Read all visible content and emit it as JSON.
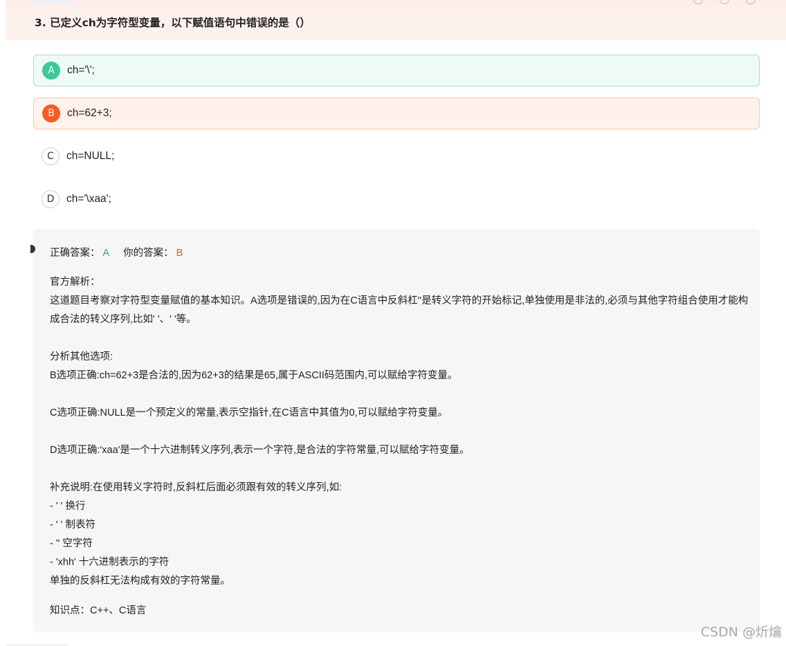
{
  "question": {
    "title": "3. 已定义ch为字符型变量，以下赋值语句中错误的是（）"
  },
  "options": [
    {
      "letter": "A",
      "text": "ch='\\';",
      "state": "correct"
    },
    {
      "letter": "B",
      "text": "ch=62+3;",
      "state": "wrong"
    },
    {
      "letter": "C",
      "text": "ch=NULL;",
      "state": "plain"
    },
    {
      "letter": "D",
      "text": "ch='\\xaa';",
      "state": "plain"
    }
  ],
  "analysis": {
    "correct_label": "正确答案：",
    "correct_value": "A",
    "your_label": "你的答案：",
    "your_value": "B",
    "lines": [
      "官方解析：",
      "这道题目考察对字符型变量赋值的基本知识。A选项是错误的,因为在C语言中反斜杠''是转义字符的开始标记,单独使用是非法的,必须与其他字符组合使用才能构成合法的转义序列,比如' '、' '等。",
      "",
      "分析其他选项:",
      "B选项正确:ch=62+3是合法的,因为62+3的结果是65,属于ASCII码范围内,可以赋给字符变量。",
      "",
      "C选项正确:NULL是一个预定义的常量,表示空指针,在C语言中其值为0,可以赋给字符变量。",
      "",
      "D选项正确:'xaa'是一个十六进制转义序列,表示一个字符,是合法的字符常量,可以赋给字符变量。",
      "",
      "补充说明:在使用转义字符时,反斜杠后面必须跟有效的转义序列,如:",
      "- ' ' 换行",
      "- ' ' 制表符",
      "- '' 空字符",
      "- 'xhh' 十六进制表示的字符",
      "单独的反斜杠无法构成有效的字符常量。"
    ],
    "knowledge_point": "知识点：C++、C语言"
  },
  "watermark": "CSDN @炘爚",
  "colors": {
    "correct": "#3dc99a",
    "wrong": "#f25c22",
    "header_bg": "#fdf1ee",
    "analysis_bg": "#f6f6f6"
  }
}
